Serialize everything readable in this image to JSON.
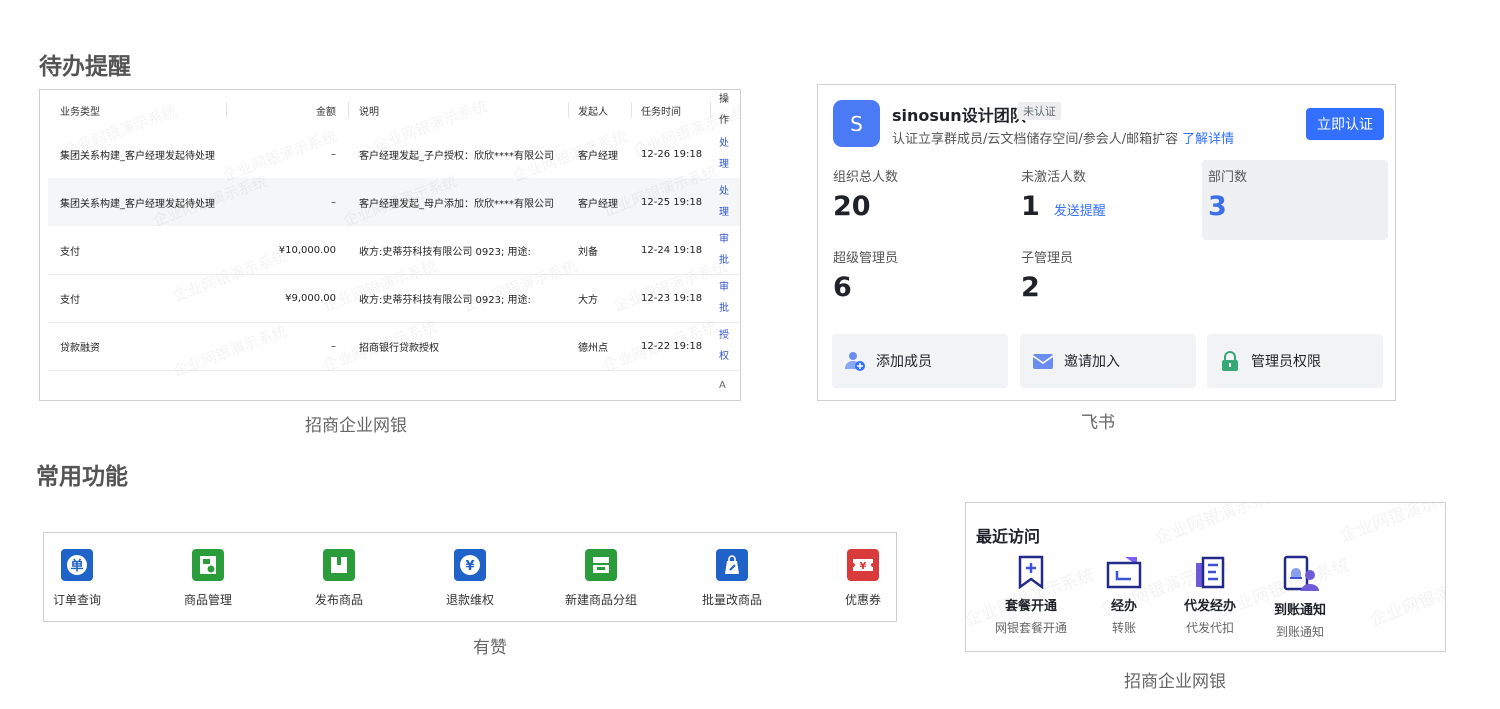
{
  "section_todo": "待办提醒",
  "section_common": "常用功能",
  "todo_table": {
    "caption": "招商企业网银",
    "watermark": "企业网银演示系统",
    "headers": {
      "type": "业务类型",
      "amount": "金额",
      "desc": "说明",
      "initiator": "发起人",
      "time": "任务时间",
      "op": [
        "操",
        "作"
      ]
    },
    "rows": [
      {
        "type": "集团关系构建_客户经理发起待处理",
        "amount": "–",
        "desc": "客户经理发起_子户授权：欣欣****有限公司",
        "initiator": "客户经理",
        "time": "12-26 19:18",
        "op": [
          "处",
          "理"
        ]
      },
      {
        "type": "集团关系构建_客户经理发起待处理",
        "amount": "–",
        "desc": "客户经理发起_母户添加：欣欣****有限公司",
        "initiator": "客户经理",
        "time": "12-25 19:18",
        "op": [
          "处",
          "理"
        ]
      },
      {
        "type": "支付",
        "amount": "¥10,000.00",
        "desc": "收方:史蒂芬科技有限公司 0923; 用途:",
        "initiator": "刘备",
        "time": "12-24 19:18",
        "op": [
          "审",
          "批"
        ]
      },
      {
        "type": "支付",
        "amount": "¥9,000.00",
        "desc": "收方:史蒂芬科技有限公司 0923; 用途:",
        "initiator": "大方",
        "time": "12-23 19:18",
        "op": [
          "审",
          "批"
        ]
      },
      {
        "type": "贷款融资",
        "amount": "–",
        "desc": "招商银行贷款授权",
        "initiator": "德州点",
        "time": "12-22 19:18",
        "op": [
          "授",
          "权"
        ]
      }
    ],
    "partial_row_op": "A"
  },
  "feishu": {
    "caption": "飞书",
    "avatar_letter": "S",
    "team_name": "sinosun设计团队",
    "badge": "未认证",
    "desc": "认证立享群成员/云文档储存空间/参会人/邮箱扩容",
    "desc_link": "了解详情",
    "verify_button": "立即认证",
    "stats": [
      {
        "label": "组织总人数",
        "value": "20"
      },
      {
        "label": "未激活人数",
        "value": "1",
        "link": "发送提醒"
      },
      {
        "label": "部门数",
        "value": "3"
      },
      {
        "label": "超级管理员",
        "value": "6"
      },
      {
        "label": "子管理员",
        "value": "2"
      }
    ],
    "actions": [
      {
        "label": "添加成员",
        "icon": "add-member-icon"
      },
      {
        "label": "邀请加入",
        "icon": "invite-mail-icon"
      },
      {
        "label": "管理员权限",
        "icon": "lock-icon"
      }
    ]
  },
  "youzan": {
    "caption": "有赞",
    "functions": [
      {
        "label": "订单查询",
        "icon_text": "单",
        "color": "#1f62c8"
      },
      {
        "label": "商品管理",
        "icon_text": "",
        "color": "#2a9d3a"
      },
      {
        "label": "发布商品",
        "icon_text": "",
        "color": "#2a9d3a"
      },
      {
        "label": "退款维权",
        "icon_text": "¥",
        "color": "#1f62c8"
      },
      {
        "label": "新建商品分组",
        "icon_text": "",
        "color": "#2a9d3a"
      },
      {
        "label": "批量改商品",
        "icon_text": "",
        "color": "#1f62c8"
      },
      {
        "label": "优惠券",
        "icon_text": "¥",
        "color": "#d93a3a"
      }
    ]
  },
  "recent": {
    "caption": "招商企业网银",
    "title": "最近访问",
    "items": [
      {
        "label": "套餐开通",
        "sub": "网银套餐开通"
      },
      {
        "label": "经办",
        "sub": "转账"
      },
      {
        "label": "代发经办",
        "sub": "代发代扣"
      },
      {
        "label": "到账通知",
        "sub": "到账通知"
      }
    ]
  }
}
